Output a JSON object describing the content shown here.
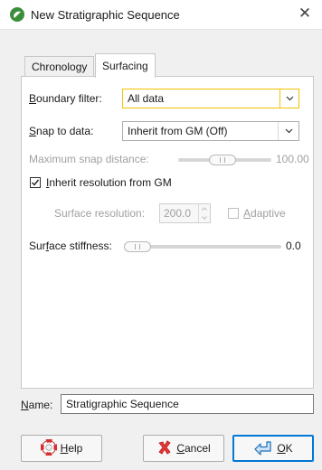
{
  "window": {
    "title": "New Stratigraphic Sequence",
    "close_glyph": "✕"
  },
  "tabs": [
    {
      "label": "Chronology",
      "active": false
    },
    {
      "label": "Surfacing",
      "active": true
    }
  ],
  "surfacing": {
    "boundary_filter": {
      "label_mnemonic": "B",
      "label_rest": "oundary filter:",
      "value": "All data"
    },
    "snap_to_data": {
      "label_mnemonic": "S",
      "label_rest": "nap to data:",
      "value": "Inherit from GM (Off)"
    },
    "max_snap_distance": {
      "label": "Maximum snap distance:",
      "value": "100.00",
      "enabled": false
    },
    "inherit_resolution": {
      "label_mnemonic": "I",
      "label_rest": "nherit resolution from GM",
      "checked": true
    },
    "surface_resolution": {
      "label": "Surface resolution:",
      "value": "200.0",
      "enabled": false
    },
    "adaptive": {
      "label_mnemonic": "A",
      "label_rest": "daptive",
      "checked": false,
      "enabled": false
    },
    "surface_stiffness": {
      "label_pre": "Sur",
      "label_mnemonic": "f",
      "label_rest": "ace stiffness:",
      "value": "0.0"
    }
  },
  "name_field": {
    "label_mnemonic": "N",
    "label_rest": "ame:",
    "value": "Stratigraphic Sequence"
  },
  "buttons": {
    "help": {
      "mnemonic": "H",
      "rest": "elp"
    },
    "cancel": {
      "mnemonic": "C",
      "rest": "ancel"
    },
    "ok": {
      "mnemonic": "O",
      "rest": "K"
    }
  },
  "colors": {
    "accent_focus": "#f2c200",
    "primary_border": "#0078d4",
    "app_icon": "#3a8d3a"
  },
  "icons": {
    "app": "leapfrog-logo-icon",
    "help": "lifebuoy-icon",
    "cancel": "cancel-x-icon",
    "ok": "ok-arrow-icon"
  }
}
